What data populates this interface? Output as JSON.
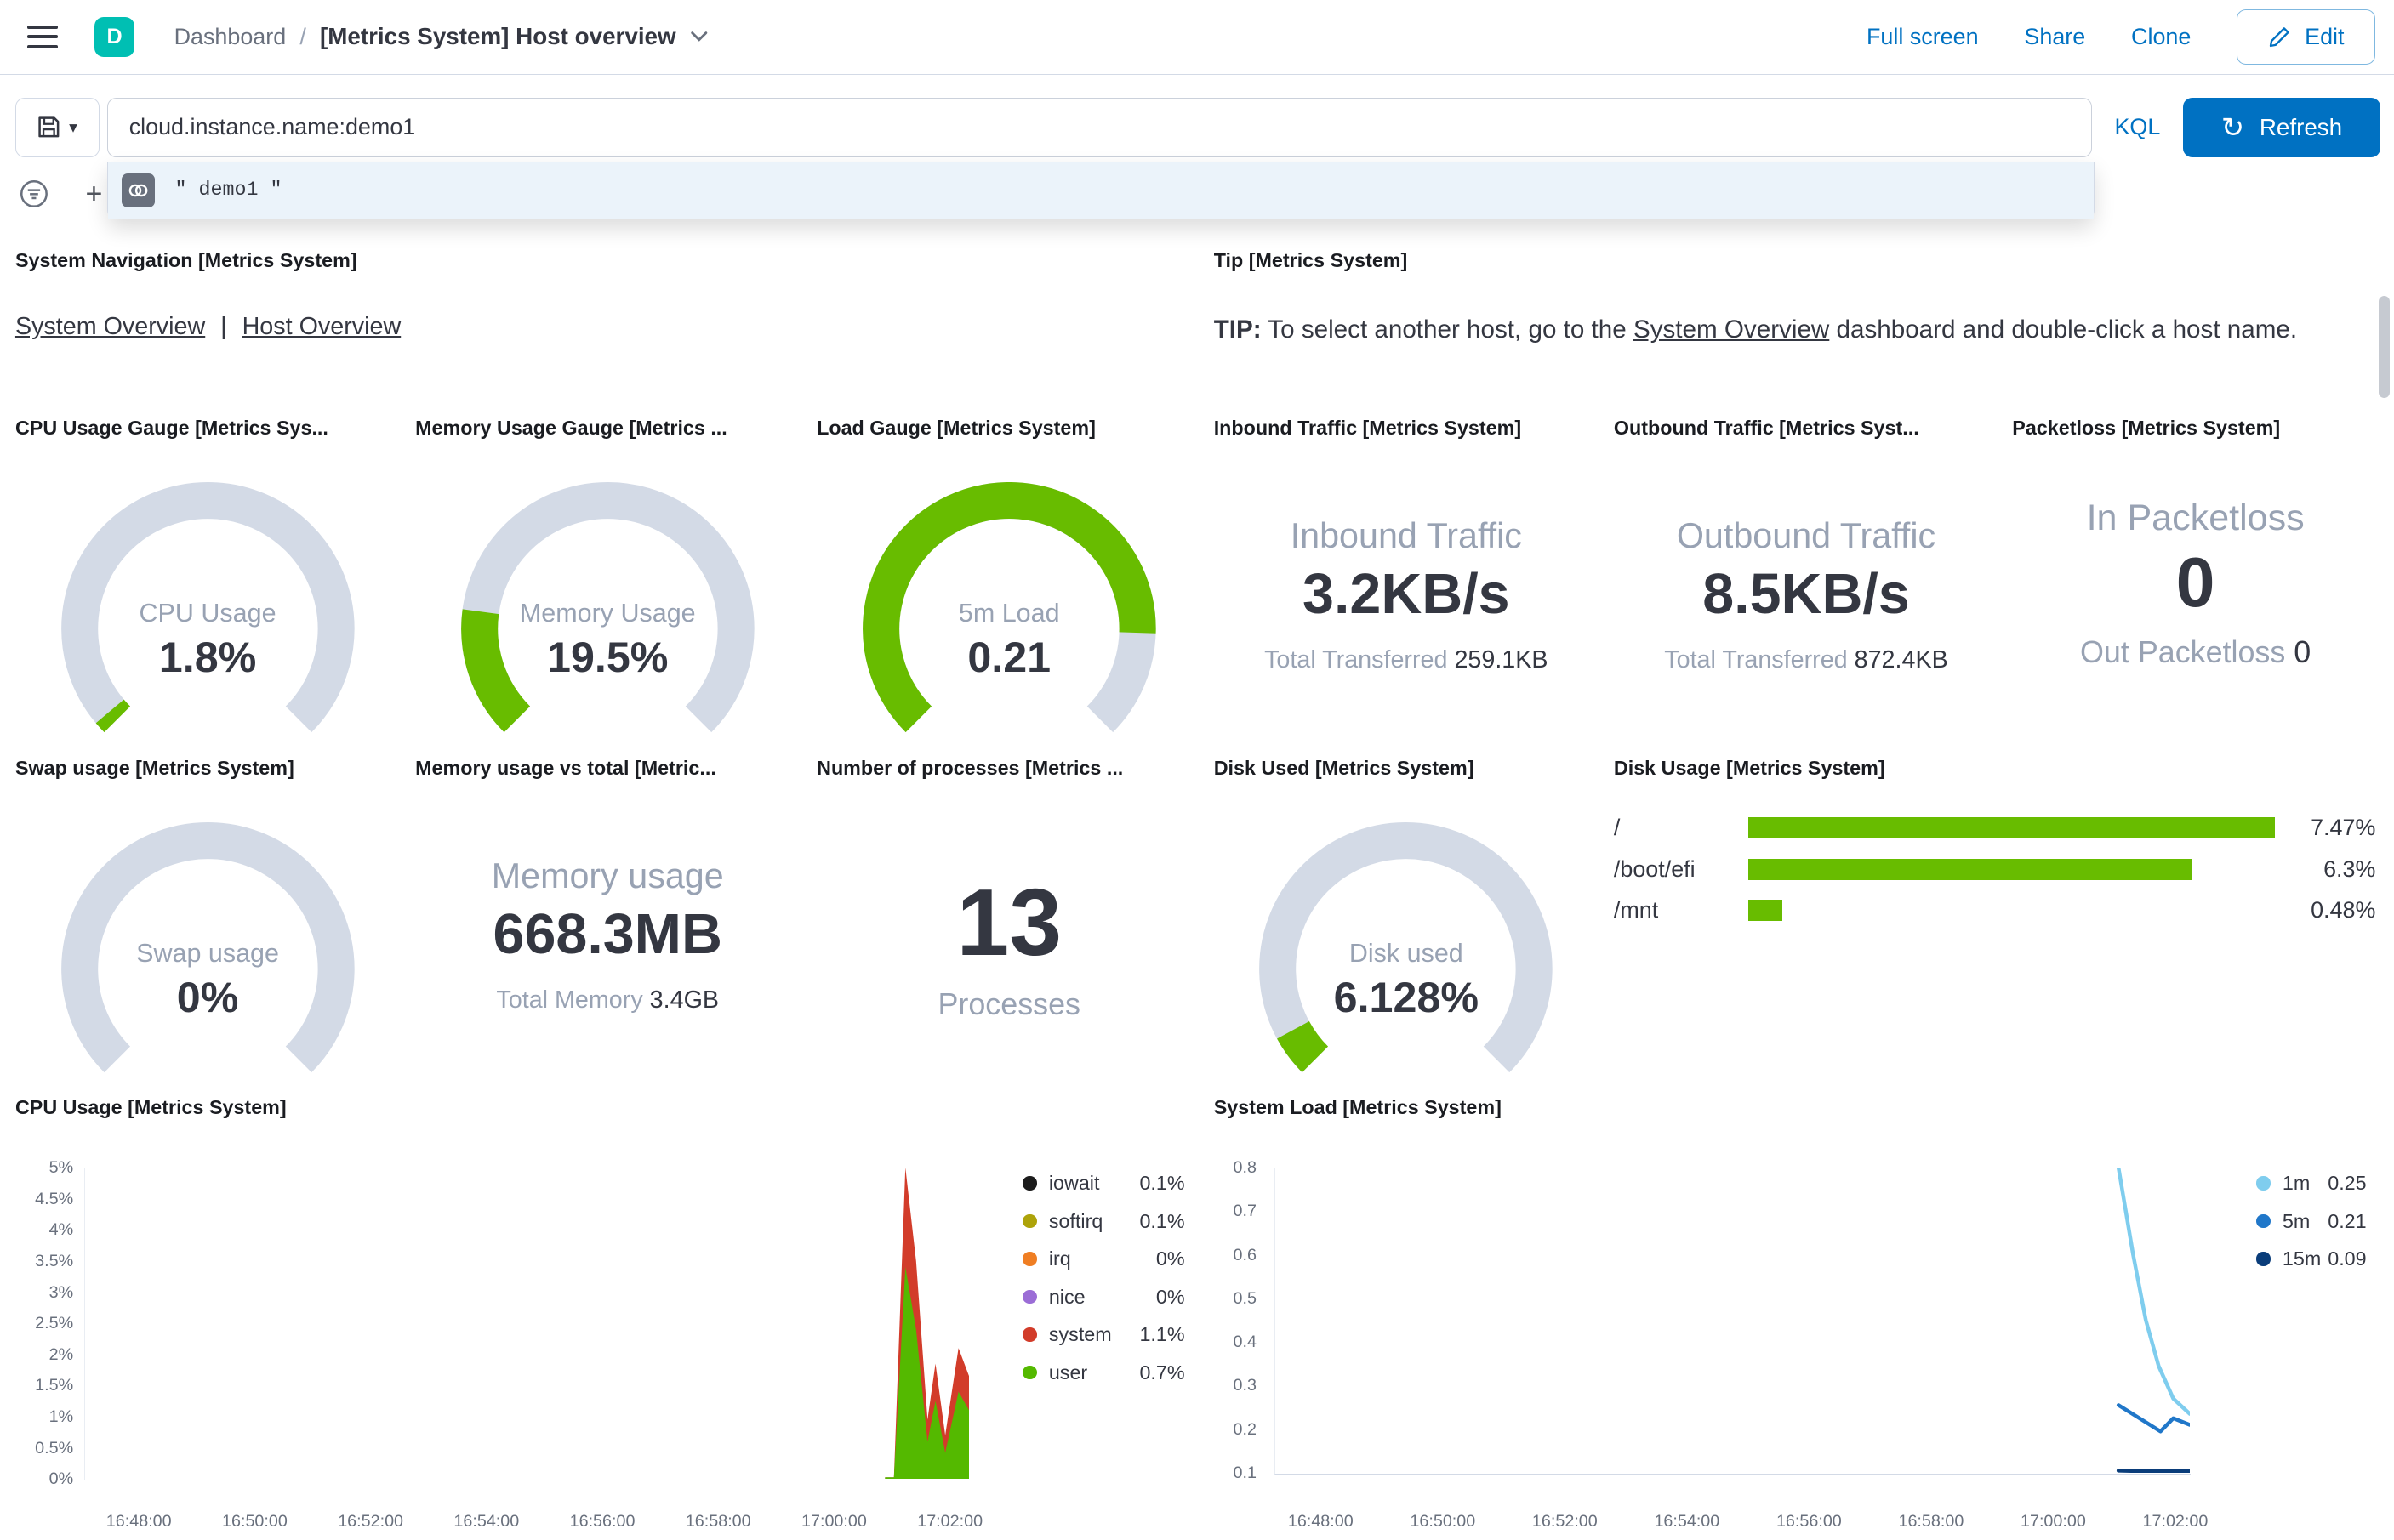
{
  "colors": {
    "primary": "#0071C2",
    "green": "#68BC00",
    "gauge_track": "#D3DAE6",
    "avatar": "#00BFB3"
  },
  "header": {
    "space_initial": "D",
    "breadcrumb_root": "Dashboard",
    "breadcrumb_sep": "/",
    "title": "[Metrics System] Host overview",
    "full_screen": "Full screen",
    "share": "Share",
    "clone": "Clone",
    "edit": "Edit"
  },
  "query_bar": {
    "query": "cloud.instance.name:demo1",
    "language": "KQL",
    "refresh": "Refresh",
    "add_filter": "+",
    "suggestion_text": "\" demo1 \""
  },
  "nav_panel": {
    "title": "System Navigation [Metrics System]",
    "link_system": "System Overview",
    "separator": "|",
    "link_host": "Host Overview"
  },
  "tip_panel": {
    "title": "Tip [Metrics System]",
    "bold": "TIP:",
    "before": " To select another host, go to the ",
    "link": "System Overview",
    "after": " dashboard and double-click a host name."
  },
  "gauges": {
    "cpu": {
      "title": "CPU Usage Gauge [Metrics Sys...",
      "label": "CPU Usage",
      "value": "1.8%",
      "fraction": 0.018
    },
    "memory": {
      "title": "Memory Usage Gauge [Metrics ...",
      "label": "Memory Usage",
      "value": "19.5%",
      "fraction": 0.195
    },
    "load": {
      "title": "Load Gauge [Metrics System]",
      "label": "5m Load",
      "value": "0.21",
      "fraction": 0.84
    },
    "swap": {
      "title": "Swap usage [Metrics System]",
      "label": "Swap usage",
      "value": "0%",
      "fraction": 0
    },
    "disk": {
      "title": "Disk Used [Metrics System]",
      "label": "Disk used",
      "value": "6.128%",
      "fraction": 0.061
    }
  },
  "metrics": {
    "inbound": {
      "title": "Inbound Traffic [Metrics System]",
      "label": "Inbound Traffic",
      "value": "3.2KB/s",
      "sub_label": "Total Transferred",
      "sub_value": "259.1KB"
    },
    "outbound": {
      "title": "Outbound Traffic [Metrics Syst...",
      "label": "Outbound Traffic",
      "value": "8.5KB/s",
      "sub_label": "Total Transferred",
      "sub_value": "872.4KB"
    },
    "packetloss": {
      "title": "Packetloss [Metrics System]",
      "label": "In Packetloss",
      "value": "0",
      "sub_label": "Out Packetloss",
      "sub_value": "0"
    },
    "memory_total": {
      "title": "Memory usage vs total [Metric...",
      "label": "Memory usage",
      "value": "668.3MB",
      "sub_label": "Total Memory",
      "sub_value": "3.4GB"
    },
    "processes": {
      "title": "Number of processes [Metrics ...",
      "value": "13",
      "label": "Processes"
    }
  },
  "disk_usage": {
    "title": "Disk Usage [Metrics System]",
    "max": 7.47,
    "rows": [
      {
        "label": "/",
        "value": 7.47,
        "display": "7.47%"
      },
      {
        "label": "/boot/efi",
        "value": 6.3,
        "display": "6.3%"
      },
      {
        "label": "/mnt",
        "value": 0.48,
        "display": "0.48%"
      }
    ]
  },
  "chart_data": [
    {
      "id": "cpu-usage",
      "type": "area",
      "title": "CPU Usage [Metrics System]",
      "ylim": [
        0,
        5
      ],
      "y_ticks": [
        "5%",
        "4.5%",
        "4%",
        "3.5%",
        "3%",
        "2.5%",
        "2%",
        "1.5%",
        "1%",
        "0.5%",
        "0%"
      ],
      "x_ticks": [
        "16:48:00",
        "16:50:00",
        "16:52:00",
        "16:54:00",
        "16:56:00",
        "16:58:00",
        "17:00:00",
        "17:02:00"
      ],
      "x_range": [
        0.062,
        0.978
      ],
      "legend_position": "right",
      "grid": false,
      "series": [
        {
          "name": "iowait",
          "legend_value": "0.1%",
          "color": "#1C1C1C",
          "points": []
        },
        {
          "name": "softirq",
          "legend_value": "0.1%",
          "color": "#ADA30A",
          "points": []
        },
        {
          "name": "irq",
          "legend_value": "0%",
          "color": "#EF7E23",
          "points": []
        },
        {
          "name": "nice",
          "legend_value": "0%",
          "color": "#9B6DD6",
          "points": []
        },
        {
          "name": "system",
          "legend_value": "1.1%",
          "color": "#D23C2A",
          "points": [
            [
              0.905,
              0
            ],
            [
              0.915,
              0
            ],
            [
              0.928,
              5.0
            ],
            [
              0.94,
              3.5
            ],
            [
              0.953,
              0.95
            ],
            [
              0.962,
              1.85
            ],
            [
              0.973,
              0.7
            ],
            [
              0.988,
              2.1
            ],
            [
              1,
              1.65
            ]
          ]
        },
        {
          "name": "user",
          "legend_value": "0.7%",
          "color": "#54B900",
          "points": [
            [
              0.905,
              0
            ],
            [
              0.915,
              0
            ],
            [
              0.928,
              3.4
            ],
            [
              0.94,
              2.4
            ],
            [
              0.953,
              0.6
            ],
            [
              0.962,
              1.25
            ],
            [
              0.973,
              0.42
            ],
            [
              0.988,
              1.4
            ],
            [
              1,
              1.1
            ]
          ]
        }
      ]
    },
    {
      "id": "system-load",
      "type": "line",
      "title": "System Load [Metrics System]",
      "ylim": [
        0.1,
        0.8
      ],
      "y_ticks": [
        "0.8",
        "0.7",
        "0.6",
        "0.5",
        "0.4",
        "0.3",
        "0.2",
        "0.1"
      ],
      "x_ticks": [
        "16:48:00",
        "16:50:00",
        "16:52:00",
        "16:54:00",
        "16:56:00",
        "16:58:00",
        "17:00:00",
        "17:02:00"
      ],
      "x_range": [
        0.05,
        0.983
      ],
      "legend_position": "right",
      "grid": false,
      "series": [
        {
          "name": "1m",
          "legend_value": "0.25",
          "color": "#7FCDEE",
          "points": [
            [
              0.922,
              0.8
            ],
            [
              0.938,
              0.6
            ],
            [
              0.952,
              0.45
            ],
            [
              0.966,
              0.345
            ],
            [
              0.982,
              0.27
            ],
            [
              1,
              0.235
            ]
          ]
        },
        {
          "name": "5m",
          "legend_value": "0.21",
          "color": "#2077C9",
          "points": [
            [
              0.922,
              0.255
            ],
            [
              0.945,
              0.225
            ],
            [
              0.968,
              0.195
            ],
            [
              0.982,
              0.225
            ],
            [
              1,
              0.21
            ]
          ]
        },
        {
          "name": "15m",
          "legend_value": "0.09",
          "color": "#0A3D7A",
          "points": [
            [
              0.922,
              0.105
            ],
            [
              0.95,
              0.1
            ],
            [
              0.965,
              0.1
            ],
            [
              0.98,
              0.093
            ],
            [
              1,
              0.093
            ]
          ]
        }
      ]
    }
  ]
}
